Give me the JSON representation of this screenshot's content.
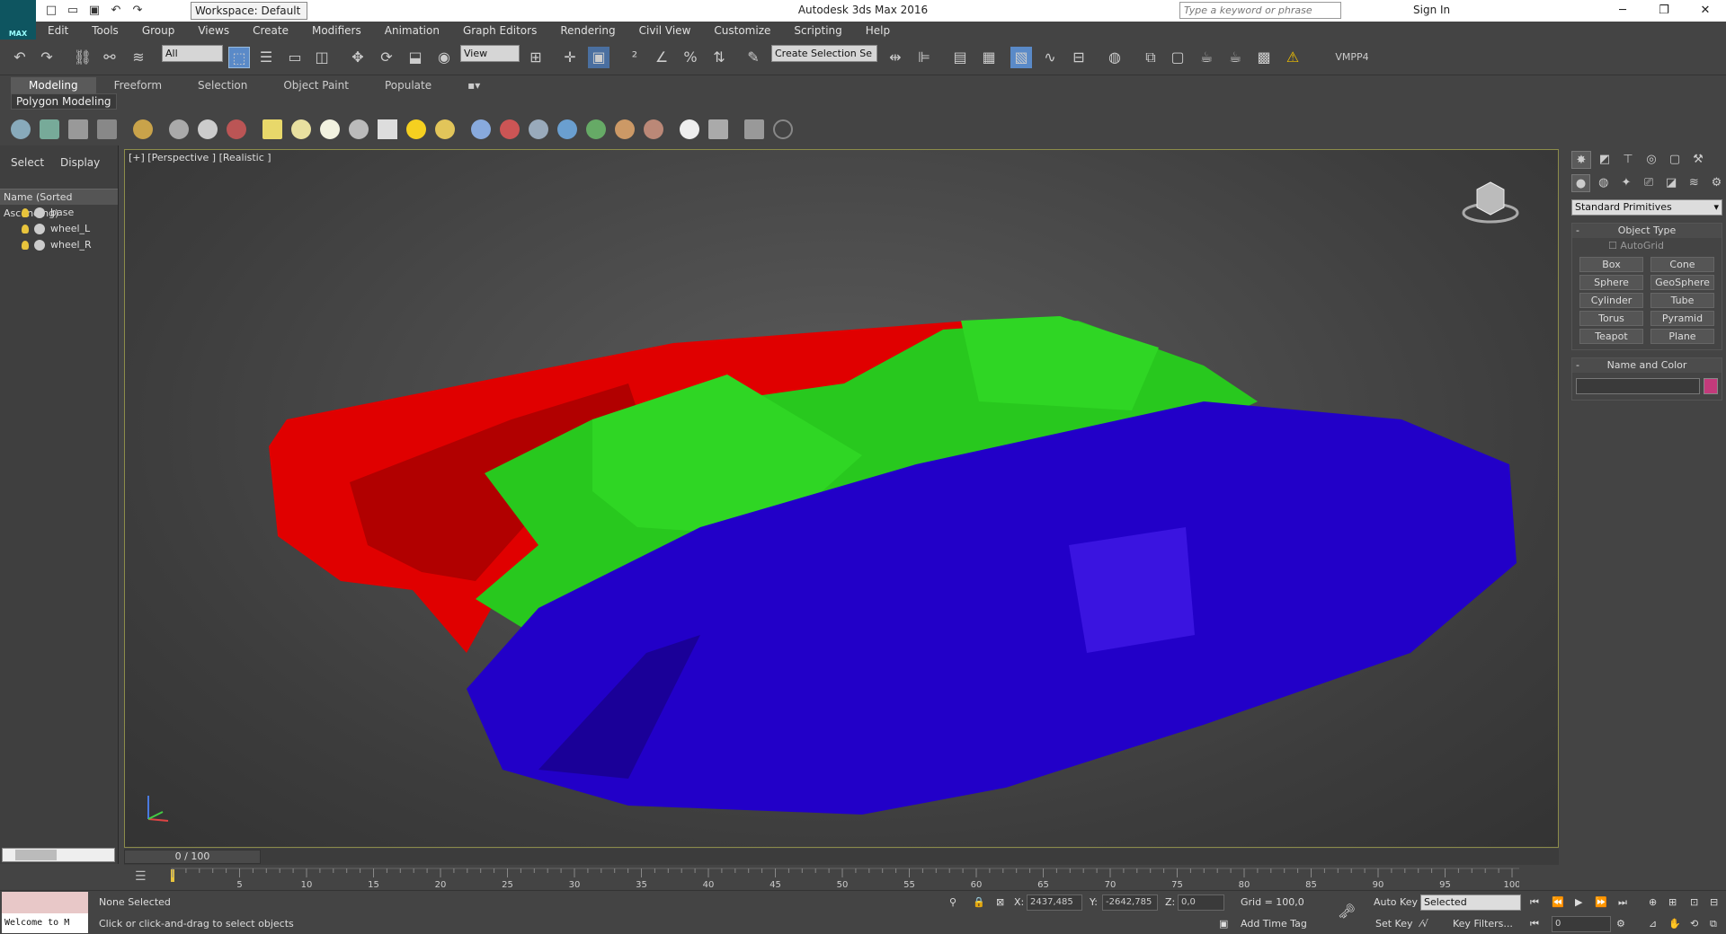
{
  "app": {
    "title": "Autodesk 3ds Max 2016",
    "workspace": "Workspace: Default",
    "logo_label": "MAX",
    "search_placeholder": "Type a keyword or phrase",
    "sign_in": "Sign In"
  },
  "menu": [
    "Edit",
    "Tools",
    "Group",
    "Views",
    "Create",
    "Modifiers",
    "Animation",
    "Graph Editors",
    "Rendering",
    "Civil View",
    "Customize",
    "Scripting",
    "Help"
  ],
  "toolbar": {
    "filter_value": "All",
    "ref_coord_value": "View",
    "selection_set_value": "Create Selection Se",
    "plugin_label": "VMPP4"
  },
  "ribbon": {
    "tabs": [
      "Modeling",
      "Freeform",
      "Selection",
      "Object Paint",
      "Populate"
    ],
    "active_tab": "Modeling",
    "panel_label": "Polygon Modeling"
  },
  "scene_explorer": {
    "tabs": [
      "Select",
      "Display"
    ],
    "header": "Name (Sorted Ascending)",
    "items": [
      "base",
      "wheel_L",
      "wheel_R"
    ]
  },
  "viewport": {
    "label": "[+] [Perspective ] [Realistic ]",
    "colors": {
      "red_track": "#e00000",
      "green_hull": "#28c81e",
      "blue_track": "#2200c8"
    }
  },
  "command_panel": {
    "category": "Standard Primitives",
    "object_type_title": "Object Type",
    "autogrid": "AutoGrid",
    "primitives": [
      "Box",
      "Cone",
      "Sphere",
      "GeoSphere",
      "Cylinder",
      "Tube",
      "Torus",
      "Pyramid",
      "Teapot",
      "Plane"
    ],
    "name_color_title": "Name and Color",
    "object_color": "#c33a7b"
  },
  "timeline": {
    "frame_counter": "0 / 100",
    "ticks": [
      "5",
      "10",
      "15",
      "20",
      "25",
      "30",
      "35",
      "40",
      "45",
      "50",
      "55",
      "60",
      "65",
      "70",
      "75",
      "80",
      "85",
      "90",
      "95",
      "100"
    ]
  },
  "status": {
    "welcome": "Welcome to M",
    "selection": "None Selected",
    "prompt": "Click or click-and-drag to select objects",
    "x_label": "X:",
    "x_value": "2437,485",
    "y_label": "Y:",
    "y_value": "-2642,785",
    "z_label": "Z:",
    "z_value": "0,0",
    "grid": "Grid = 100,0",
    "add_time_tag": "Add Time Tag",
    "auto_key": "Auto Key",
    "set_key": "Set Key",
    "key_mode": "Selected",
    "key_filters": "Key Filters...",
    "current_frame": "0"
  }
}
